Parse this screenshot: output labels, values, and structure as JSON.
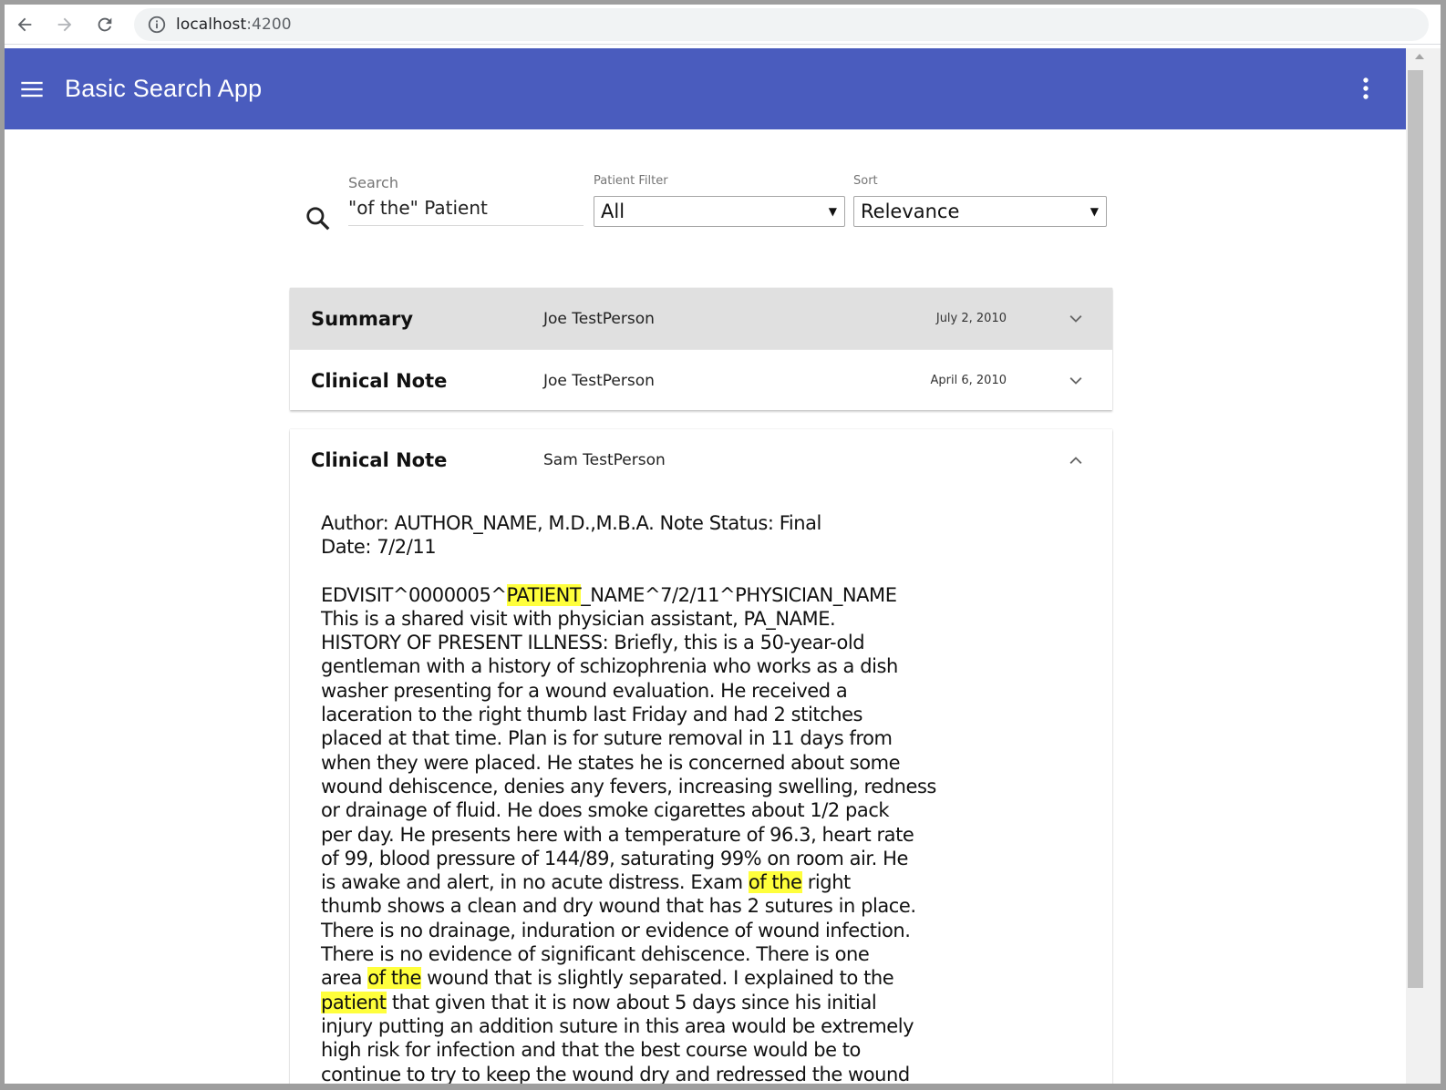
{
  "browser": {
    "url_host": "localhost",
    "url_port": ":4200"
  },
  "toolbar": {
    "title": "Basic Search App"
  },
  "search": {
    "label": "Search",
    "value": "\"of the\" Patient"
  },
  "patient_filter": {
    "label": "Patient Filter",
    "selected": "All"
  },
  "sort": {
    "label": "Sort",
    "selected": "Relevance"
  },
  "results": [
    {
      "type": "Summary",
      "patient": "Joe TestPerson",
      "date": "July 2, 2010",
      "active": true
    },
    {
      "type": "Clinical Note",
      "patient": "Joe TestPerson",
      "date": "April 6, 2010",
      "active": false
    }
  ],
  "expanded": {
    "type": "Clinical Note",
    "patient": "Sam TestPerson",
    "header_line1": "Author: AUTHOR_NAME, M.D.,M.B.A. Note Status: Final",
    "header_line2": "Date: 7/2/11",
    "segments": [
      {
        "text": "EDVISIT^0000005^",
        "hl": false
      },
      {
        "text": "PATIENT",
        "hl": true
      },
      {
        "text": "_NAME^7/2/11^PHYSICIAN_NAME\nThis is a shared visit with physician assistant, PA_NAME.\nHISTORY OF PRESENT ILLNESS: Briefly, this is a 50-year-old\ngentleman with a history of schizophrenia who works as a dish\nwasher presenting for a wound evaluation. He received a\nlaceration to the right thumb last Friday and had 2 stitches\nplaced at that time. Plan is for suture removal in 11 days from\nwhen they were placed. He states he is concerned about some\nwound dehiscence, denies any fevers, increasing swelling, redness\nor drainage of fluid. He does smoke cigarettes about 1/2 pack\nper day. He presents here with a temperature of 96.3, heart rate\nof 99, blood pressure of 144/89, saturating 99% on room air. He\nis awake and alert, in no acute distress. Exam ",
        "hl": false
      },
      {
        "text": "of the",
        "hl": true
      },
      {
        "text": " right\nthumb shows a clean and dry wound that has 2 sutures in place.\nThere is no drainage, induration or evidence of wound infection.\nThere is no evidence of significant dehiscence. There is one\narea ",
        "hl": false
      },
      {
        "text": "of the",
        "hl": true
      },
      {
        "text": " wound that is slightly separated. I explained to the\n",
        "hl": false
      },
      {
        "text": "patient",
        "hl": true
      },
      {
        "text": " that given that it is now about 5 days since his initial\ninjury putting an addition suture in this area would be extremely\nhigh risk for infection and that the best course would be to\ncontinue to try to keep the wound dry and redressed the wound",
        "hl": false
      }
    ]
  },
  "colors": {
    "primary": "#4a5cbe",
    "highlight": "#ffff3c",
    "active_row": "#e0e0e0"
  },
  "icons": [
    "back-arrow-icon",
    "forward-arrow-icon",
    "reload-icon",
    "info-icon",
    "menu-icon",
    "more-vert-icon",
    "search-icon",
    "chevron-down-icon",
    "chevron-up-icon"
  ]
}
